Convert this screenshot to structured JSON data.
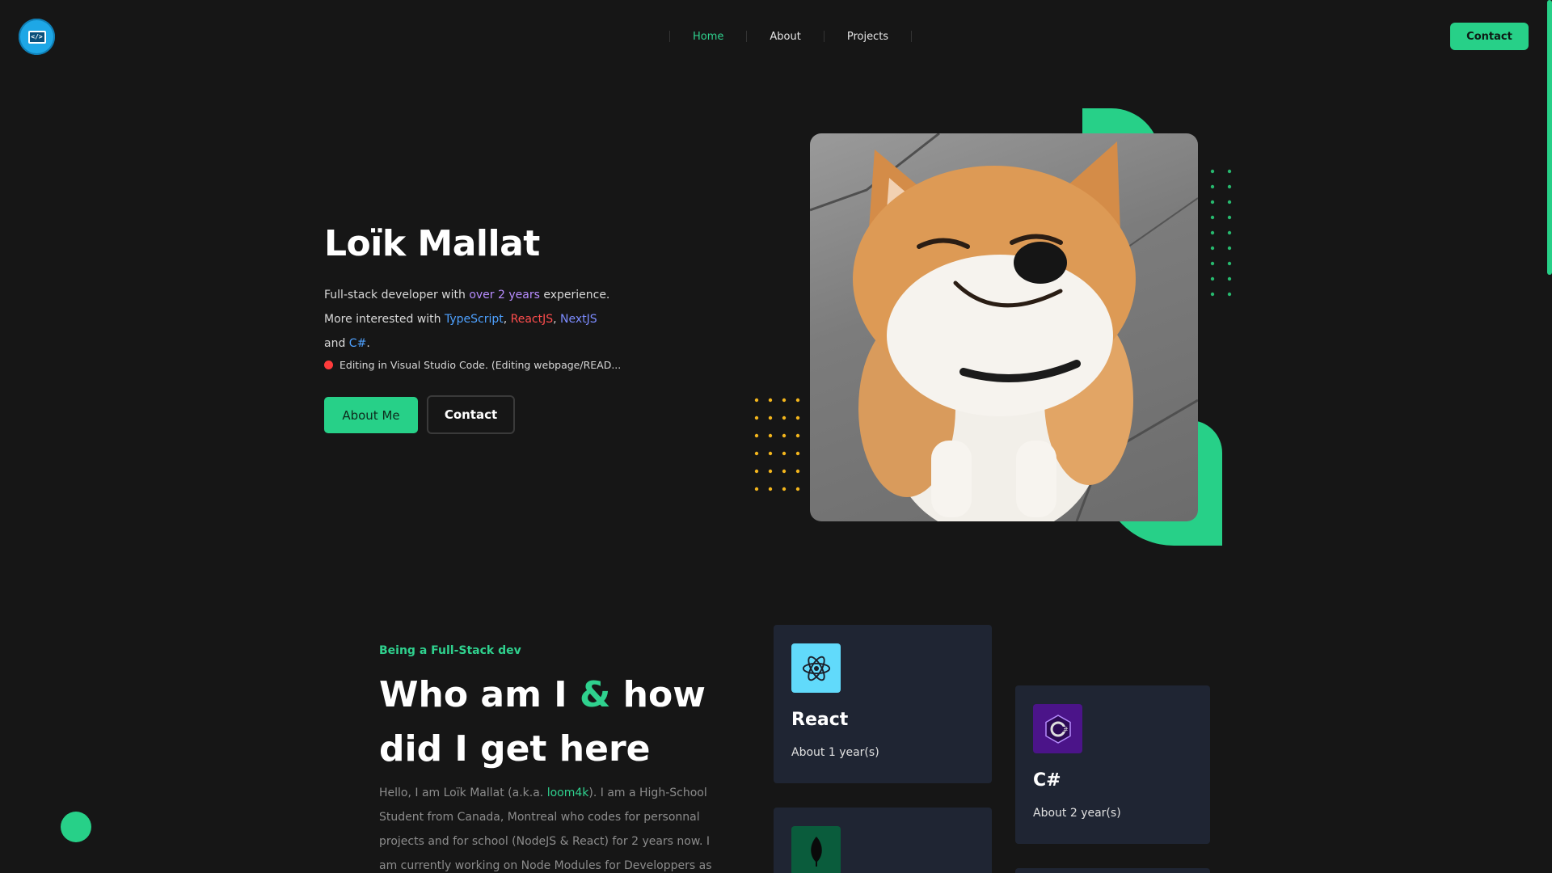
{
  "header": {
    "logo_icon": "code-window-icon",
    "logo_glyph": "</>",
    "nav": [
      {
        "label": "Home",
        "active": true
      },
      {
        "label": "About",
        "active": false
      },
      {
        "label": "Projects",
        "active": false
      }
    ],
    "contact_label": "Contact"
  },
  "hero": {
    "name": "Loïk Mallat",
    "line1_pre": "Full-stack developer with ",
    "line1_hl": "over 2 years",
    "line1_post": " experience.",
    "line2_pre": "More interested with ",
    "typescript": "TypeScript",
    "comma1": ", ",
    "reactjs": "ReactJS",
    "comma2": ", ",
    "nextjs": "NextJS",
    "and": " and ",
    "csharp": "C#",
    "period": ".",
    "status": "Editing in Visual Studio Code. (Editing webpage/READ...",
    "about_btn": "About Me",
    "contact_btn": "Contact",
    "image": "smiling-shiba-inu-dog",
    "accent_green": "#27d088",
    "dot_yellow": "#f3b51c"
  },
  "about": {
    "eyebrow": "Being a Full-Stack dev",
    "title_a": "Who am I ",
    "title_amp": "&",
    "title_b": " how did I get here",
    "bio_pre": "Hello, I am Loïk Mallat (a.k.a. ",
    "bio_hl": "loom4k",
    "bio_post": "). I am a High-School Student from Canada, Montreal who codes for personnal projects and for school (NodeJS & React) for 2 years now. I am currently working on Node Modules for Developpers as"
  },
  "skills": [
    {
      "name": "React",
      "duration": "About 1 year(s)",
      "icon": "react-atom-icon",
      "color": "#61dafb"
    },
    {
      "name": "C#",
      "duration": "About 2 year(s)",
      "icon": "csharp-icon",
      "color": "#5a1a9a"
    },
    {
      "name": "",
      "duration": "",
      "icon": "mongodb-leaf-icon",
      "color": "#0a5c3c"
    }
  ]
}
